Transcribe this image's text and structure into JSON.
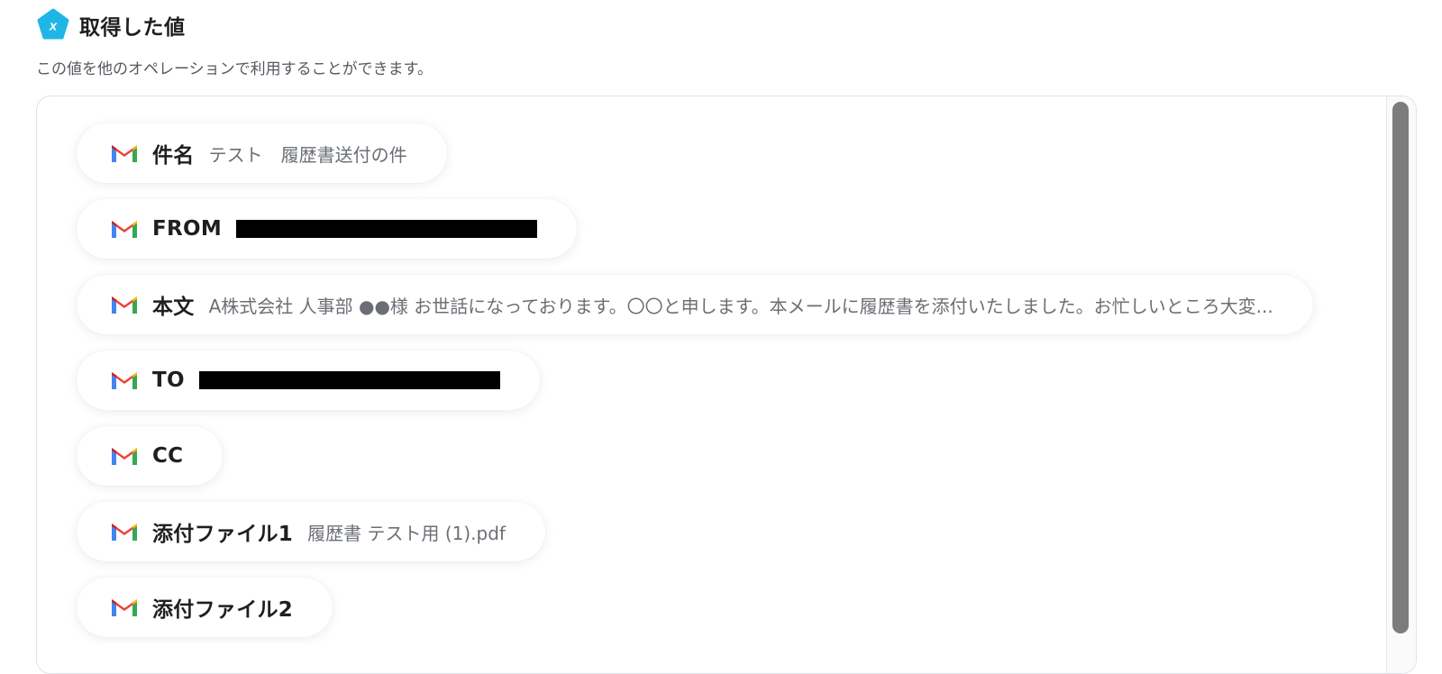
{
  "header": {
    "title": "取得した値",
    "icon": "variable-x-icon",
    "icon_color": "#1FB6E6"
  },
  "description": "この値を他のオペレーションで利用することができます。",
  "chips": [
    {
      "label": "件名",
      "value": "テスト　履歴書送付の件",
      "icon": "gmail-icon"
    },
    {
      "label": "FROM",
      "redacted": true,
      "icon": "gmail-icon"
    },
    {
      "label": "本文",
      "value": "A株式会社 人事部 ●●様 お世話になっております。〇〇と申します。本メールに履歴書を添付いたしました。お忙しいところ大変...",
      "icon": "gmail-icon"
    },
    {
      "label": "TO",
      "redacted": true,
      "icon": "gmail-icon"
    },
    {
      "label": "CC",
      "value": "",
      "icon": "gmail-icon"
    },
    {
      "label": "添付ファイル1",
      "value": "履歴書 テスト用 (1).pdf",
      "icon": "gmail-icon"
    },
    {
      "label": "添付ファイル2",
      "value": "",
      "icon": "gmail-icon"
    }
  ],
  "colors": {
    "gmail_red": "#EA4335",
    "gmail_blue": "#4285F4",
    "gmail_green": "#34A853",
    "gmail_yellow": "#FBBC04"
  }
}
